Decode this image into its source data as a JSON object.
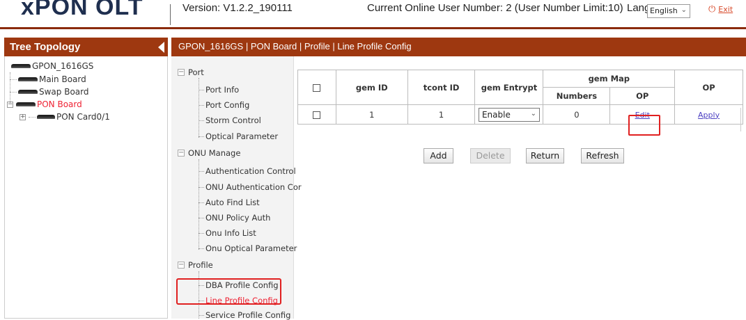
{
  "header": {
    "logo": "xPON OLT",
    "version": "Version: V1.2.2_190111",
    "online_users": "Current Online User Number: 2 (User Number Limit:10)",
    "lang_label": "Lang",
    "lang_value": "English",
    "exit_label": "Exit"
  },
  "tree": {
    "title": "Tree Topology",
    "root": "GPON_1616GS",
    "items": [
      "Main Board",
      "Swap Board",
      "PON Board",
      "PON Card0/1"
    ]
  },
  "breadcrumb": "GPON_1616GS | PON Board | Profile | Line Profile Config",
  "menu": {
    "port": {
      "label": "Port",
      "items": [
        "Port Info",
        "Port Config",
        "Storm Control",
        "Optical Parameter"
      ]
    },
    "onu": {
      "label": "ONU Manage",
      "items": [
        "Authentication Control",
        "ONU Authentication Cor",
        "Auto Find List",
        "ONU Policy Auth",
        "Onu Info List",
        "Onu Optical Parameter"
      ]
    },
    "profile": {
      "label": "Profile",
      "items": [
        "DBA Profile Config",
        "Line Profile Config",
        "Service Profile Config"
      ]
    }
  },
  "table": {
    "headers": {
      "gem_id": "gem ID",
      "tcont_id": "tcont ID",
      "gem_entrypt": "gem Entrypt",
      "gem_map": "gem Map",
      "numbers": "Numbers",
      "op": "OP",
      "op2": "OP"
    },
    "rows": [
      {
        "gem_id": "1",
        "tcont_id": "1",
        "entrypt": "Enable",
        "numbers": "0",
        "op": "Edit",
        "op2": "Apply"
      }
    ]
  },
  "buttons": {
    "add": "Add",
    "delete": "Delete",
    "return": "Return",
    "refresh": "Refresh"
  },
  "colors": {
    "accent": "#9e3810",
    "highlight": "#e02020",
    "link": "#4b3fc2"
  }
}
